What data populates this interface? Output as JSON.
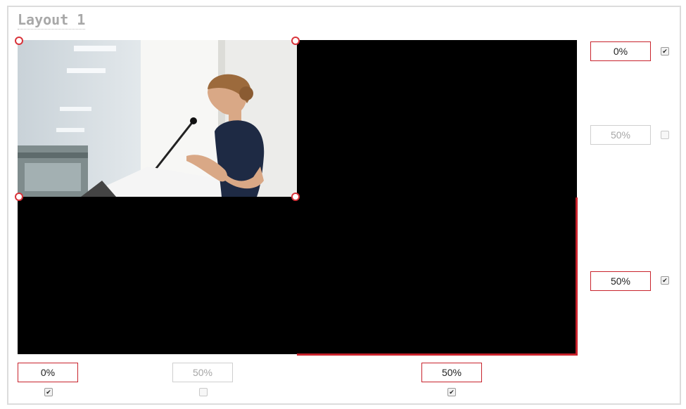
{
  "layout": {
    "title": "Layout 1"
  },
  "guides": {
    "top_right": {
      "value": "0%",
      "checked": true
    },
    "mid_right": {
      "value": "50%",
      "checked": false
    },
    "lower_right": {
      "value": "50%",
      "checked": true
    },
    "bottom_left": {
      "value": "0%",
      "checked": true
    },
    "bottom_mid": {
      "value": "50%",
      "checked": false
    },
    "bottom_right": {
      "value": "50%",
      "checked": true
    }
  },
  "colors": {
    "accent": "#c8232c",
    "canvas": "#000000",
    "title": "#a8a8a8"
  },
  "icons": {
    "checkbox": "checkbox-icon",
    "handle": "resize-handle-icon"
  }
}
